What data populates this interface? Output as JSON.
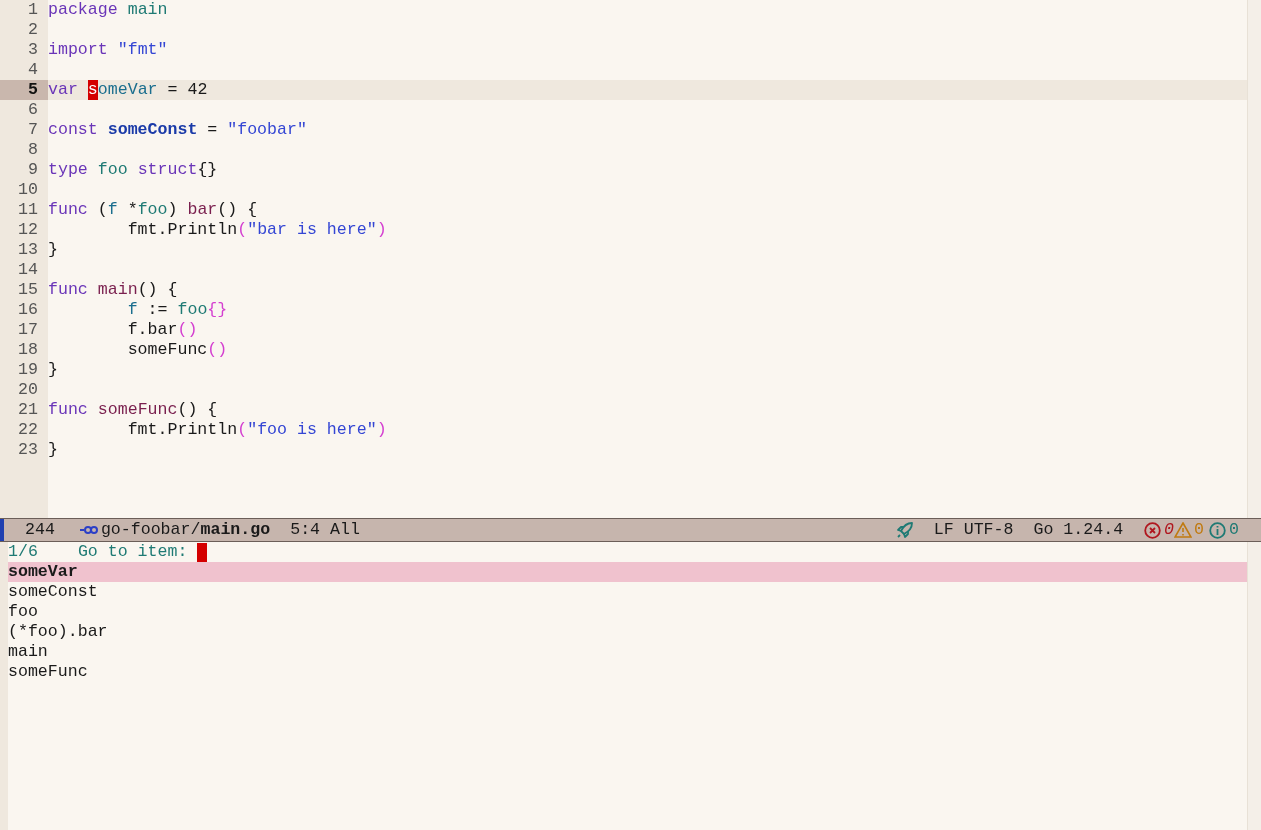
{
  "editor": {
    "lines": [
      {
        "number": "1",
        "current": false,
        "tokens": [
          {
            "text": "package ",
            "kind": "keyword"
          },
          {
            "text": "main",
            "kind": "name"
          }
        ]
      },
      {
        "number": "2",
        "current": false
      },
      {
        "number": "3",
        "current": false,
        "tokens": [
          {
            "text": "import ",
            "kind": "keyword"
          },
          {
            "text": "\"fmt\"",
            "kind": "string"
          }
        ]
      },
      {
        "number": "4",
        "current": false
      },
      {
        "number": "5",
        "current": true,
        "tokens": [
          {
            "text": "var ",
            "kind": "keyword"
          },
          {
            "text": "s",
            "kind": "cursor"
          },
          {
            "text": "omeVar",
            "kind": "variable"
          },
          {
            "text": " = 42",
            "kind": "plain"
          }
        ]
      },
      {
        "number": "6",
        "current": false
      },
      {
        "number": "7",
        "current": false,
        "tokens": [
          {
            "text": "const ",
            "kind": "keyword"
          },
          {
            "text": "someConst",
            "kind": "constant"
          },
          {
            "text": " = ",
            "kind": "plain"
          },
          {
            "text": "\"foobar\"",
            "kind": "string"
          }
        ]
      },
      {
        "number": "8",
        "current": false
      },
      {
        "number": "9",
        "current": false,
        "tokens": [
          {
            "text": "type ",
            "kind": "keyword"
          },
          {
            "text": "foo ",
            "kind": "name"
          },
          {
            "text": "struct",
            "kind": "keyword"
          },
          {
            "text": "{}",
            "kind": "plain"
          }
        ]
      },
      {
        "number": "10",
        "current": false
      },
      {
        "number": "11",
        "current": false,
        "tokens": [
          {
            "text": "func",
            "kind": "keyword"
          },
          {
            "text": " (",
            "kind": "plain"
          },
          {
            "text": "f",
            "kind": "variable"
          },
          {
            "text": " *",
            "kind": "plain"
          },
          {
            "text": "foo",
            "kind": "name"
          },
          {
            "text": ") ",
            "kind": "plain"
          },
          {
            "text": "bar",
            "kind": "function"
          },
          {
            "text": "() {",
            "kind": "plain"
          }
        ]
      },
      {
        "number": "12",
        "current": false,
        "tokens": [
          {
            "text": "        fmt.Println",
            "kind": "plain"
          },
          {
            "text": "(",
            "kind": "paren"
          },
          {
            "text": "\"bar is here\"",
            "kind": "string"
          },
          {
            "text": ")",
            "kind": "paren"
          }
        ]
      },
      {
        "number": "13",
        "current": false,
        "tokens": [
          {
            "text": "}",
            "kind": "plain"
          }
        ]
      },
      {
        "number": "14",
        "current": false
      },
      {
        "number": "15",
        "current": false,
        "tokens": [
          {
            "text": "func ",
            "kind": "keyword"
          },
          {
            "text": "main",
            "kind": "function"
          },
          {
            "text": "() {",
            "kind": "plain"
          }
        ]
      },
      {
        "number": "16",
        "current": false,
        "tokens": [
          {
            "text": "        f",
            "kind": "variable"
          },
          {
            "text": " := ",
            "kind": "plain"
          },
          {
            "text": "foo",
            "kind": "name"
          },
          {
            "text": "{}",
            "kind": "paren"
          }
        ]
      },
      {
        "number": "17",
        "current": false,
        "tokens": [
          {
            "text": "        f.bar",
            "kind": "plain"
          },
          {
            "text": "()",
            "kind": "paren"
          }
        ]
      },
      {
        "number": "18",
        "current": false,
        "tokens": [
          {
            "text": "        someFunc",
            "kind": "plain"
          },
          {
            "text": "()",
            "kind": "paren"
          }
        ]
      },
      {
        "number": "19",
        "current": false,
        "tokens": [
          {
            "text": "}",
            "kind": "plain"
          }
        ]
      },
      {
        "number": "20",
        "current": false
      },
      {
        "number": "21",
        "current": false,
        "tokens": [
          {
            "text": "func ",
            "kind": "keyword"
          },
          {
            "text": "someFunc",
            "kind": "function"
          },
          {
            "text": "() {",
            "kind": "plain"
          }
        ]
      },
      {
        "number": "22",
        "current": false,
        "tokens": [
          {
            "text": "        fmt.Println",
            "kind": "plain"
          },
          {
            "text": "(",
            "kind": "paren"
          },
          {
            "text": "\"foo is here\"",
            "kind": "string"
          },
          {
            "text": ")",
            "kind": "paren"
          }
        ]
      },
      {
        "number": "23",
        "current": false,
        "tokens": [
          {
            "text": "}",
            "kind": "plain"
          }
        ]
      }
    ]
  },
  "mode_line": {
    "line_count": "244",
    "file": "go-foobar/**main.go**",
    "position": "5:4 All",
    "encoding": "LF UTF-8",
    "language": "Go 1.24.4",
    "errors": "0",
    "warnings": "0",
    "infos": "0"
  },
  "minibuffer": {
    "counter": "1/6",
    "prompt": "Go to item:",
    "candidates": [
      {
        "label": "someVar",
        "selected": true
      },
      {
        "label": "someConst",
        "selected": false
      },
      {
        "label": "foo",
        "selected": false
      },
      {
        "label": "(*foo).bar",
        "selected": false
      },
      {
        "label": "main",
        "selected": false
      },
      {
        "label": "someFunc",
        "selected": false
      }
    ]
  }
}
